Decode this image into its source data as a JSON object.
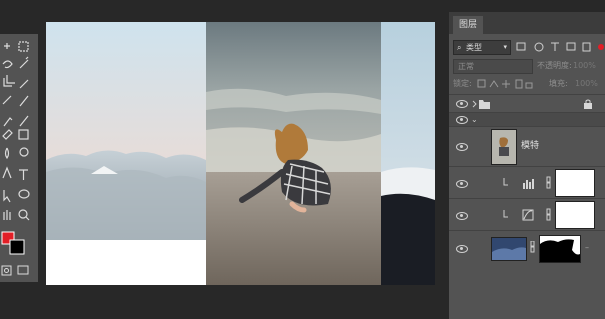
{
  "layers_panel": {
    "tab": "图层",
    "filter_kind": "类型",
    "blend_mode": "正常",
    "opacity_label": "不透明度:",
    "opacity_value": "100%",
    "lock_label": "锁定:",
    "fill_label": "填充:",
    "fill_value": "100%",
    "layers": [
      {
        "type": "group"
      },
      {
        "type": "smart-object",
        "name": "模特"
      },
      {
        "type": "adjustment",
        "icon": "levels-icon"
      },
      {
        "type": "adjustment",
        "icon": "curves-icon"
      },
      {
        "type": "image-with-mask"
      }
    ]
  },
  "colors": {
    "foreground": "#e21e26",
    "background": "#000000",
    "ui_dark": "#282828",
    "ui_panel": "#535353"
  }
}
